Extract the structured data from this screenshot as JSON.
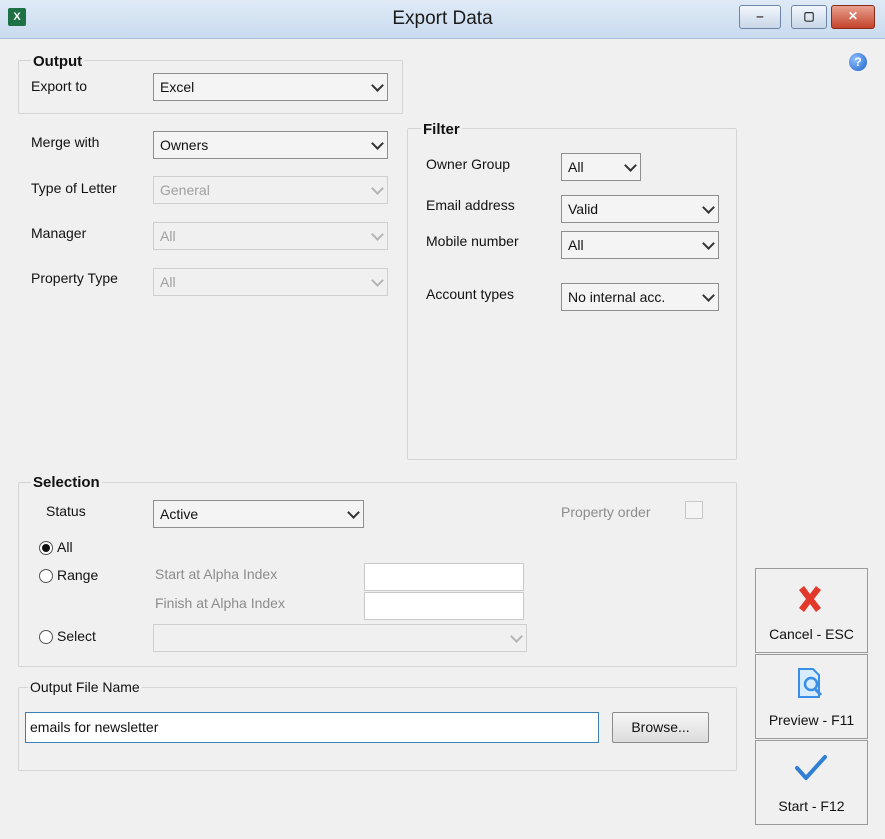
{
  "window": {
    "title": "Export Data",
    "app_icon": "excel-icon",
    "controls": {
      "minimize": "‒",
      "maximize": "▢",
      "close": "✕"
    }
  },
  "output": {
    "group_label": "Output",
    "export_to_label": "Export to",
    "export_to_value": "Excel"
  },
  "merge": {
    "merge_with_label": "Merge with",
    "merge_with_value": "Owners",
    "type_of_letter_label": "Type of Letter",
    "type_of_letter_value": "General",
    "manager_label": "Manager",
    "manager_value": "All",
    "property_type_label": "Property Type",
    "property_type_value": "All"
  },
  "filter": {
    "group_label": "Filter",
    "owner_group_label": "Owner Group",
    "owner_group_value": "All",
    "email_label": "Email address",
    "email_value": "Valid",
    "mobile_label": "Mobile number",
    "mobile_value": "All",
    "account_types_label": "Account types",
    "account_types_value": "No internal acc."
  },
  "selection": {
    "group_label": "Selection",
    "status_label": "Status",
    "status_value": "Active",
    "property_order_label": "Property order",
    "radio_all": "All",
    "radio_range": "Range",
    "radio_select": "Select",
    "start_label": "Start at Alpha Index",
    "finish_label": "Finish at Alpha Index",
    "start_value": "",
    "finish_value": "",
    "select_value": "",
    "selected_radio": "All"
  },
  "output_file": {
    "group_label": "Output File Name",
    "value": "emails for newsletter",
    "browse_label": "Browse..."
  },
  "actions": {
    "cancel_label": "Cancel - ESC",
    "preview_label": "Preview - F11",
    "start_label": "Start - F12"
  },
  "colors": {
    "cancel_icon": "#e3392b",
    "check_icon": "#2f7fd6",
    "preview_icon": "#3a8ee6"
  }
}
